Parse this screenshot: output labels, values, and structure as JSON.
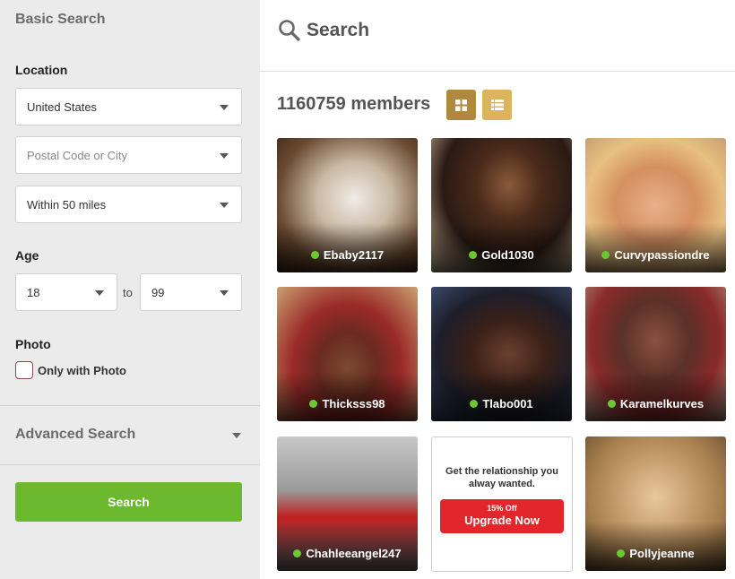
{
  "sidebar": {
    "title": "Basic Search",
    "location_label": "Location",
    "country": "United States",
    "postal_placeholder": "Postal Code or City",
    "distance": "Within 50 miles",
    "age_label": "Age",
    "age_min": "18",
    "age_to": "to",
    "age_max": "99",
    "photo_label": "Photo",
    "photo_checkbox_label": "Only with Photo",
    "photo_checked": false,
    "advanced_label": "Advanced Search",
    "search_button": "Search"
  },
  "header": {
    "title": "Search"
  },
  "results": {
    "count_text": "1160759 members",
    "view_mode": "grid",
    "members": [
      {
        "name": "Ebaby2117",
        "online": true
      },
      {
        "name": "Gold1030",
        "online": true
      },
      {
        "name": "Curvypassiondre",
        "online": true
      },
      {
        "name": "Thicksss98",
        "online": true
      },
      {
        "name": "Tlabo001",
        "online": true
      },
      {
        "name": "Karamelkurves",
        "online": true
      },
      {
        "name": "Chahleeangel247",
        "online": true
      },
      {
        "name": "Pollyjeanne",
        "online": true
      }
    ]
  },
  "promo": {
    "text": "Get the relationship you alway wanted.",
    "discount": "15% Off",
    "button": "Upgrade Now"
  },
  "colors": {
    "accent_green": "#6cb82f",
    "online_dot": "#6cc830",
    "view_grid_active": "#b0883f",
    "view_list": "#dbb45d",
    "promo_red": "#e2262c"
  }
}
